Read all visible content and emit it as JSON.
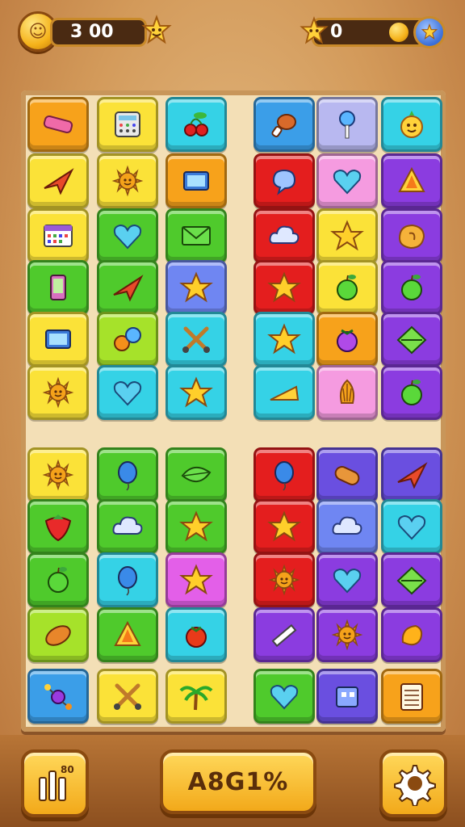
{
  "hud": {
    "score": "3 00",
    "coins": "0"
  },
  "bottom": {
    "main_button_label": "A8G1%",
    "left_button_label": "80"
  },
  "colors": {
    "orange": "#f7a21b",
    "yellow": "#fbe238",
    "cyan": "#35d2e6",
    "blue": "#3b9ee8",
    "lavender": "#b8b8f0",
    "red": "#e41e1e",
    "pink": "#f59be0",
    "purple": "#a43ad6",
    "green": "#4fca2c",
    "lime": "#a6e22a",
    "periwinkle": "#6f86f2",
    "indigo": "#6a4fe0",
    "violet": "#8b3ce0",
    "magenta": "#e35fe8"
  },
  "tiles": [
    {
      "icon": "eraser",
      "color": "orange"
    },
    {
      "icon": "calculator",
      "color": "yellow"
    },
    {
      "icon": "cherries",
      "color": "cyan"
    },
    {
      "icon": "drumstick",
      "color": "blue"
    },
    {
      "icon": "lollipop",
      "color": "lavender"
    },
    {
      "icon": "fruit-face",
      "color": "cyan"
    },
    {
      "icon": "paper-plane",
      "color": "yellow"
    },
    {
      "icon": "sun-face",
      "color": "yellow"
    },
    {
      "icon": "tablet",
      "color": "orange"
    },
    {
      "icon": "speech-cloud",
      "color": "red"
    },
    {
      "icon": "heart",
      "color": "pink"
    },
    {
      "icon": "triangle",
      "color": "violet"
    },
    {
      "icon": "calendar",
      "color": "yellow"
    },
    {
      "icon": "heart",
      "color": "green"
    },
    {
      "icon": "envelope",
      "color": "green"
    },
    {
      "icon": "cloud",
      "color": "red"
    },
    {
      "icon": "star",
      "color": "yellow"
    },
    {
      "icon": "cookie",
      "color": "violet"
    },
    {
      "icon": "phone",
      "color": "green"
    },
    {
      "icon": "paper-plane",
      "color": "green"
    },
    {
      "icon": "star",
      "color": "periwinkle"
    },
    {
      "icon": "star",
      "color": "red"
    },
    {
      "icon": "apple",
      "color": "yellow"
    },
    {
      "icon": "apple",
      "color": "violet"
    },
    {
      "icon": "tablet",
      "color": "yellow"
    },
    {
      "icon": "balls",
      "color": "lime"
    },
    {
      "icon": "scissors",
      "color": "cyan"
    },
    {
      "icon": "star",
      "color": "cyan"
    },
    {
      "icon": "grape",
      "color": "orange"
    },
    {
      "icon": "diamond",
      "color": "violet"
    },
    {
      "icon": "sun-face",
      "color": "yellow"
    },
    {
      "icon": "heart",
      "color": "cyan"
    },
    {
      "icon": "star",
      "color": "cyan"
    },
    {
      "icon": "cheese",
      "color": "cyan"
    },
    {
      "icon": "shell",
      "color": "pink"
    },
    {
      "icon": "apple",
      "color": "violet"
    },
    {
      "icon": "sun-face",
      "color": "yellow"
    },
    {
      "icon": "balloon",
      "color": "green"
    },
    {
      "icon": "leaf",
      "color": "green"
    },
    {
      "icon": "balloon",
      "color": "red"
    },
    {
      "icon": "bread",
      "color": "indigo"
    },
    {
      "icon": "paper-plane",
      "color": "indigo"
    },
    {
      "icon": "strawberry",
      "color": "green"
    },
    {
      "icon": "cloud",
      "color": "green"
    },
    {
      "icon": "star",
      "color": "green"
    },
    {
      "icon": "star",
      "color": "red"
    },
    {
      "icon": "cloud",
      "color": "periwinkle"
    },
    {
      "icon": "heart",
      "color": "cyan"
    },
    {
      "icon": "apple",
      "color": "green"
    },
    {
      "icon": "balloon",
      "color": "cyan"
    },
    {
      "icon": "star",
      "color": "magenta"
    },
    {
      "icon": "sun-face",
      "color": "red"
    },
    {
      "icon": "heart",
      "color": "violet"
    },
    {
      "icon": "diamond",
      "color": "violet"
    },
    {
      "icon": "peanut",
      "color": "lime"
    },
    {
      "icon": "triangle",
      "color": "green"
    },
    {
      "icon": "tomato",
      "color": "cyan"
    },
    {
      "icon": "pencil",
      "color": "violet"
    },
    {
      "icon": "sun-face",
      "color": "violet"
    },
    {
      "icon": "mango",
      "color": "violet"
    },
    {
      "icon": "molecule",
      "color": "blue"
    },
    {
      "icon": "scissors",
      "color": "yellow"
    },
    {
      "icon": "palm",
      "color": "yellow"
    },
    {
      "icon": "heart",
      "color": "green"
    },
    {
      "icon": "robot",
      "color": "indigo"
    },
    {
      "icon": "notebook",
      "color": "orange"
    }
  ]
}
